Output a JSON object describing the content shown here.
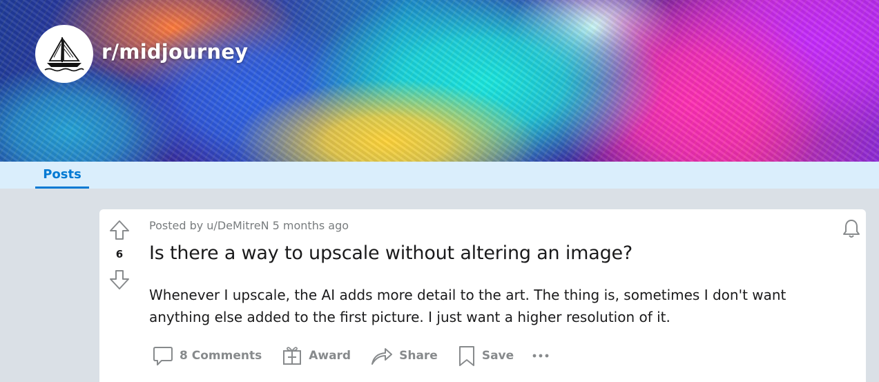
{
  "subreddit": {
    "name": "r/midjourney",
    "avatar_icon": "sailboat-icon"
  },
  "tabs": [
    {
      "label": "Posts",
      "active": true
    }
  ],
  "post": {
    "score": "6",
    "meta_prefix": "Posted by",
    "author": "u/DeMitreN",
    "age": "5 months ago",
    "title": "Is there a way to upscale without altering an image?",
    "body": "Whenever I upscale, the AI adds more detail to the art. The thing is, sometimes I don't want anything else added to the first picture. I just want a higher resolution of it.",
    "actions": {
      "comments": "8 Comments",
      "award": "Award",
      "share": "Share",
      "save": "Save"
    }
  },
  "icons": {
    "upvote": "upvote-arrow-icon",
    "downvote": "downvote-arrow-icon",
    "notify": "bell-icon",
    "comments": "comment-bubble-icon",
    "award": "gift-box-icon",
    "share": "share-arrow-icon",
    "save": "bookmark-icon",
    "more": "ellipsis-icon"
  },
  "colors": {
    "accent": "#0079d3",
    "tab_bar": "#daeefc",
    "page_bg": "#dae0e6",
    "action_text": "#878a8c",
    "meta_text": "#787c7e"
  }
}
